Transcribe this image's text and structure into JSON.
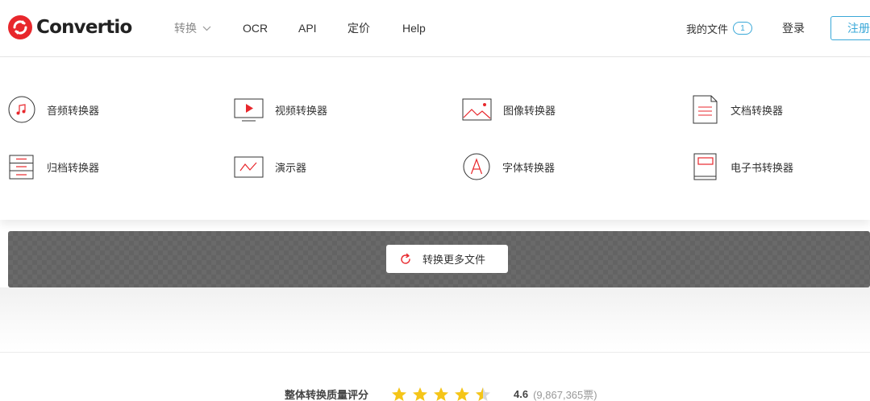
{
  "brand": {
    "name": "Convertio",
    "color": "#e8272c"
  },
  "nav": {
    "convert": "转换",
    "ocr": "OCR",
    "api": "API",
    "pricing": "定价",
    "help": "Help"
  },
  "header_right": {
    "my_files": "我的文件",
    "files_count": "1",
    "login": "登录",
    "signup": "注册"
  },
  "converters": [
    {
      "label": "音频转换器",
      "icon": "audio-icon"
    },
    {
      "label": "视频转换器",
      "icon": "video-icon"
    },
    {
      "label": "图像转换器",
      "icon": "image-icon"
    },
    {
      "label": "文档转换器",
      "icon": "document-icon"
    },
    {
      "label": "归档转换器",
      "icon": "archive-icon"
    },
    {
      "label": "演示器",
      "icon": "presentation-icon"
    },
    {
      "label": "字体转换器",
      "icon": "font-icon"
    },
    {
      "label": "电子书转换器",
      "icon": "ebook-icon"
    }
  ],
  "convert_more": {
    "label": "转换更多文件",
    "icon": "refresh-icon"
  },
  "rating": {
    "label": "整体转换质量评分",
    "score": "4.6",
    "votes": "(9,867,365票)",
    "stars": 4.5
  },
  "colors": {
    "accent": "#e8272c",
    "link": "#3aa8d8",
    "star": "#f5c518"
  }
}
